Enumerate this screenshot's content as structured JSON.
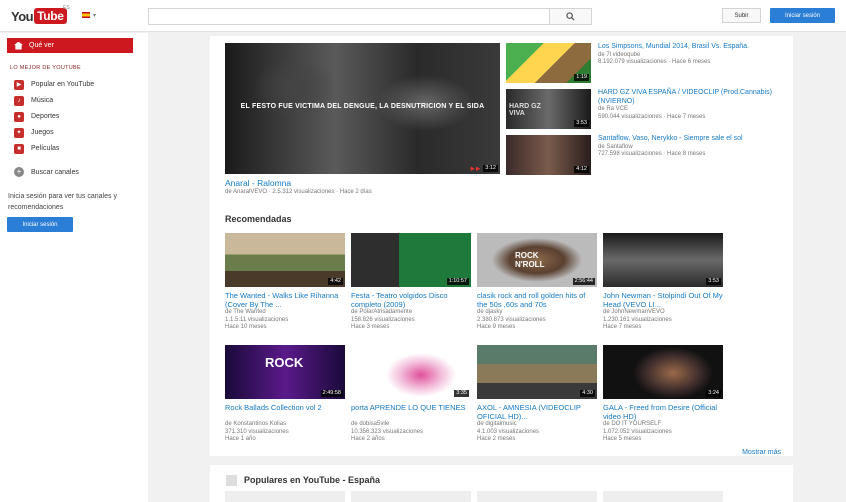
{
  "masthead": {
    "logo_you": "You",
    "logo_tube": "Tube",
    "logo_region": "ES",
    "upload_label": "Subir",
    "signin_label": "Iniciar sesión"
  },
  "sidebar": {
    "home_label": "Qué ver",
    "section_title": "LO MEJOR DE YOUTUBE",
    "items": [
      {
        "label": "Popular en YouTube",
        "icon": "popular-icon"
      },
      {
        "label": "Música",
        "icon": "music-icon"
      },
      {
        "label": "Deportes",
        "icon": "sports-icon"
      },
      {
        "label": "Juegos",
        "icon": "games-icon"
      },
      {
        "label": "Películas",
        "icon": "movies-icon"
      }
    ],
    "browse_label": "Buscar canales",
    "signin_text": "Inicia sesión para ver tus canales y recomendaciones",
    "signin_button": "Iniciar sesión"
  },
  "featured": {
    "overlay_text": "EL FESTO FUE VICTIMA DEL DENGUE, LA DESNUTRICION Y EL SIDA",
    "duration": "3:12",
    "title": "Anaral - Ralomna",
    "meta": "de AnaralVEVO · 2.5.312 visualizaciones · Hace 2 días"
  },
  "side_videos": [
    {
      "title": "Los Simpsons, Mundial 2014, Brasil Vs. España.",
      "channel": "de 7l videoqube",
      "views": "8.192.079 visualizaciones · Hace 6 meses",
      "duration": "1:19"
    },
    {
      "title": "HARD GZ VIVA ESPAÑA / VIDEOCLIP (Prod.Cannabis) (NVIERNO)",
      "channel": "de Ra VCE",
      "views": "590.044 visualizaciones · Hace 7 meses",
      "duration": "3:53"
    },
    {
      "title": "Santaflow, Vaso, Nerykko - Siempre sale el sol",
      "channel": "de Santaflow",
      "views": "727.598 visualizaciones · Hace 8 meses",
      "duration": "4:12"
    }
  ],
  "recommended_title": "Recomendadas",
  "recommended": [
    {
      "title": "The Wanted - Walks Like Rihanna (Cover By The ...",
      "channel": "de The Wanted",
      "views": "1.1.5.11 visualizaciones",
      "age": "Hace 10 meses",
      "duration": "4:42"
    },
    {
      "title": "Festa - Teatro volgidos Disco completo (2009)",
      "channel": "de PolarAtrisadamente",
      "views": "158.826 visualizaciones",
      "age": "Hace 3 meses",
      "duration": "1:10:57"
    },
    {
      "title": "clasik rock and roll golden hits of the 50s ,60s and 70s",
      "channel": "de djasky",
      "views": "2.380.873 visualizaciones",
      "age": "Hace 9 meses",
      "duration": "2:56:44"
    },
    {
      "title": "John Newman - Stolpindi Out Of My Head (VEVO LI...",
      "channel": "de JohnNewmanVEVO",
      "views": "1.230.161 visualizaciones",
      "age": "Hace 7 meses",
      "duration": "3:53"
    },
    {
      "title": "Rock Ballads Collection vol 2",
      "channel": "de Konstantinos Kolias",
      "views": "371.310 visualizaciones",
      "age": "Hace 1 año",
      "duration": "2:49:58"
    },
    {
      "title": "porta APRENDE LO QUE TIENES",
      "channel": "de dobisa5vile",
      "views": "10.356.323 visualizaciones",
      "age": "Hace 2 años",
      "duration": "3:35"
    },
    {
      "title": "AXOL - AMNESIA (VIDEOCLIP OFICIAL HD)...",
      "channel": "de digitalmusic",
      "views": "4.1.003 visualizaciones",
      "age": "Hace 2 meses",
      "duration": "4:30"
    },
    {
      "title": "GALA - Freed from Desire (Official video HD)",
      "channel": "de DO IT YOURSELF",
      "views": "1.072.052 visualizaciones",
      "age": "Hace 5 meses",
      "duration": "3:24"
    }
  ],
  "more_label": "Mostrar más",
  "popular_title": "Populares en YouTube - España",
  "colors": {
    "brand": "#cc181e",
    "link": "#167ac6",
    "button": "#2b7ed5"
  }
}
